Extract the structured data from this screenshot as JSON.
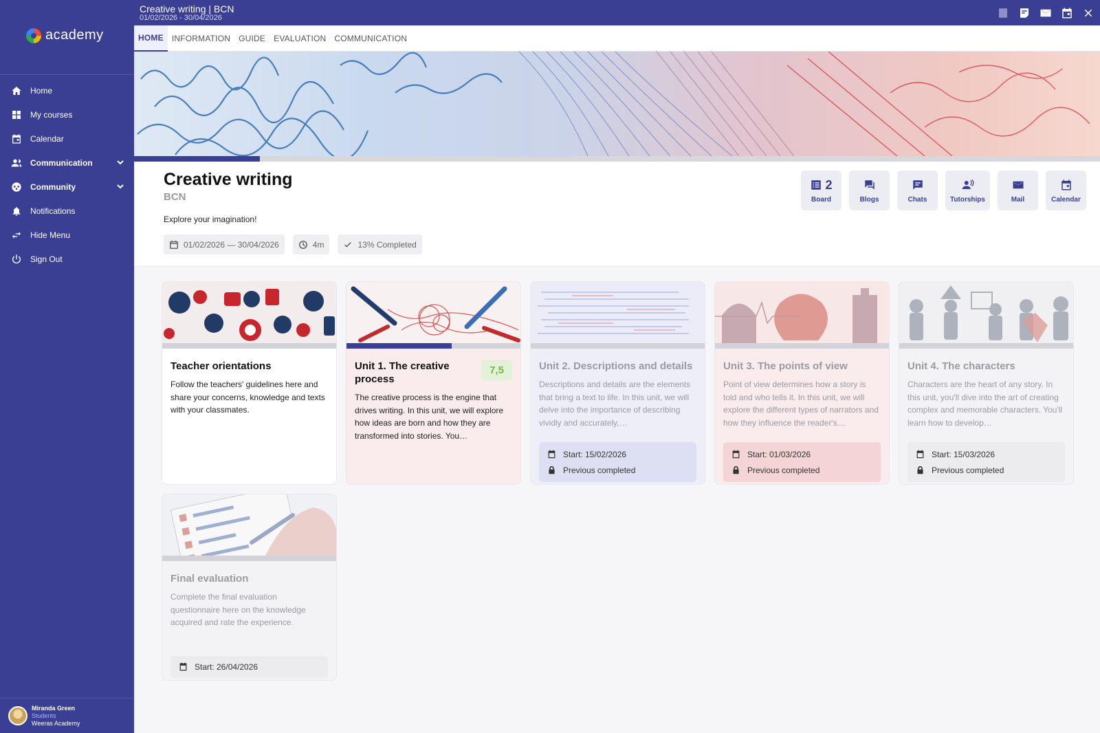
{
  "app": {
    "name": "academy"
  },
  "sidebar": {
    "items": [
      {
        "label": "Home",
        "icon": "home-icon"
      },
      {
        "label": "My courses",
        "icon": "grid-icon"
      },
      {
        "label": "Calendar",
        "icon": "calendar-icon"
      },
      {
        "label": "Communication",
        "icon": "people-icon",
        "expandable": true
      },
      {
        "label": "Community",
        "icon": "community-icon",
        "expandable": true
      },
      {
        "label": "Notifications",
        "icon": "bell-icon"
      },
      {
        "label": "Hide Menu",
        "icon": "arrows-icon"
      },
      {
        "label": "Sign Out",
        "icon": "power-icon"
      }
    ],
    "user": {
      "name": "Miranda Green",
      "role": "Students",
      "organization": "Weeras Academy"
    }
  },
  "topbar": {
    "title": "Creative writing | BCN",
    "dates": "01/02/2026 - 30/04/2026",
    "icons": [
      "help-icon",
      "notes-icon",
      "mail-icon",
      "calendar-icon",
      "close-icon"
    ]
  },
  "tabs": [
    {
      "label": "HOME",
      "active": true
    },
    {
      "label": "INFORMATION",
      "active": false
    },
    {
      "label": "GUIDE",
      "active": false
    },
    {
      "label": "EVALUATION",
      "active": false
    },
    {
      "label": "COMMUNICATION",
      "active": false
    }
  ],
  "course": {
    "progress": 0.13,
    "title": "Creative writing",
    "subtitle": "BCN",
    "description": "Explore your imagination!",
    "chips": {
      "dates": "01/02/2026 — 30/04/2026",
      "duration": "4m",
      "completed": "13% Completed"
    }
  },
  "tools": [
    {
      "label": "Board",
      "count": "2",
      "icon": "board-icon"
    },
    {
      "label": "Blogs",
      "icon": "blogs-icon"
    },
    {
      "label": "Chats",
      "icon": "chat-icon"
    },
    {
      "label": "Tutorships",
      "icon": "tutorship-icon"
    },
    {
      "label": "Mail",
      "icon": "mail-icon"
    },
    {
      "label": "Calendar",
      "icon": "calendar-icon"
    }
  ],
  "cards": [
    {
      "title": "Teacher orientations",
      "description": "Follow the teachers' guidelines here and share your concerns, knowledge and texts with your classmates.",
      "progress": 0,
      "locked": false
    },
    {
      "title": "Unit 1.  The creative process",
      "description": "The creative process is the engine that drives writing. In this unit, we will explore how ideas are born and how they are transformed into stories. You…",
      "grade": "7,5",
      "progress": 0.6,
      "locked": false
    },
    {
      "title": "Unit 2.  Descriptions and details",
      "description": "Descriptions and details are the elements that bring a text to life. In this unit, we will delve into the importance of describing vividly and accurately,…",
      "start": "Start: 15/02/2026",
      "status": "Previous completed",
      "locked": true
    },
    {
      "title": "Unit 3.  The points of view",
      "description": "Point of view determines how a story is told and who tells it. In this unit, we will explore the different types of narrators and how they influence the reader's…",
      "start": "Start: 01/03/2026",
      "status": "Previous completed",
      "locked": true
    },
    {
      "title": "Unit 4.  The characters",
      "description": "Characters are the heart of any story. In this unit, you'll dive into the art of creating complex and memorable characters. You'll learn how to develop…",
      "start": "Start: 15/03/2026",
      "status": "Previous completed",
      "locked": true
    },
    {
      "title": "Final evaluation",
      "description": "Complete the final evaluation questionnaire here on the knowledge acquired and rate the experience.",
      "start": "Start: 26/04/2026",
      "locked": true
    }
  ],
  "colors": {
    "brand": "#3b3f94",
    "grade_bg": "#e3f1d8",
    "grade_text": "#7cb342"
  }
}
